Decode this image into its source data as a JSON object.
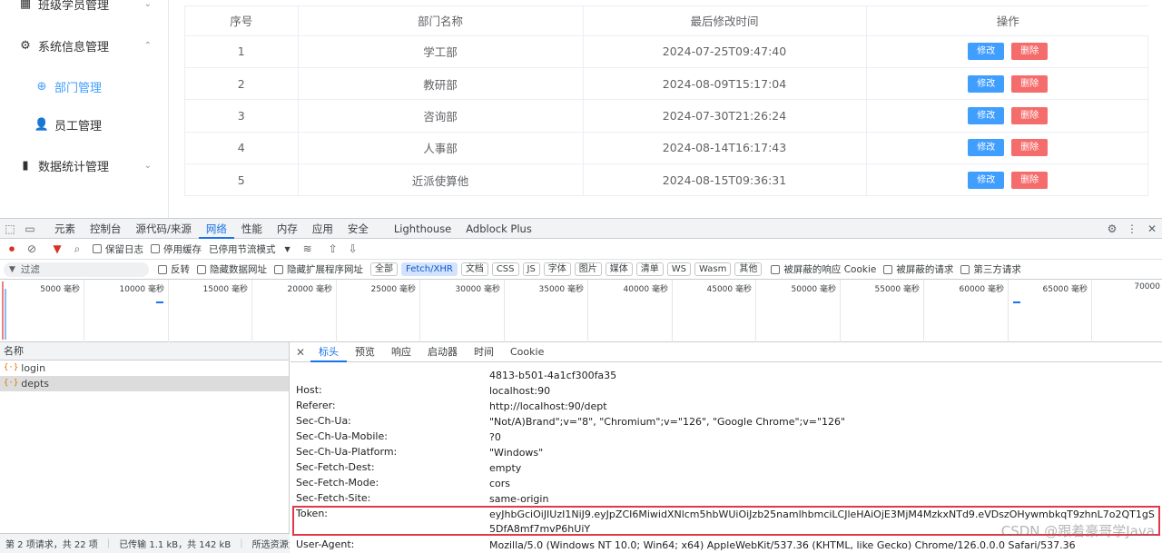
{
  "sidebar": {
    "items": [
      {
        "label": "班级学员管理",
        "icon": "grid-icon",
        "chevron": "down"
      },
      {
        "label": "系统信息管理",
        "icon": "gear-icon",
        "chevron": "up"
      },
      {
        "label": "部门管理",
        "icon": "plus-circle-icon",
        "active": true
      },
      {
        "label": "员工管理",
        "icon": "user-icon"
      },
      {
        "label": "数据统计管理",
        "icon": "bar-chart-icon",
        "chevron": "down"
      }
    ]
  },
  "table": {
    "headers": [
      "序号",
      "部门名称",
      "最后修改时间",
      "操作"
    ],
    "rows": [
      {
        "no": "1",
        "name": "学工部",
        "time": "2024-07-25T09:47:40"
      },
      {
        "no": "2",
        "name": "教研部",
        "time": "2024-08-09T15:17:04"
      },
      {
        "no": "3",
        "name": "咨询部",
        "time": "2024-07-30T21:26:24"
      },
      {
        "no": "4",
        "name": "人事部",
        "time": "2024-08-14T16:17:43"
      },
      {
        "no": "5",
        "name": "近派使算他",
        "time": "2024-08-15T09:36:31"
      }
    ],
    "edit_label": "修改",
    "delete_label": "删除"
  },
  "devtools": {
    "tabs": [
      "元素",
      "控制台",
      "源代码/来源",
      "网络",
      "性能",
      "内存",
      "应用",
      "安全",
      "Lighthouse",
      "Adblock Plus"
    ],
    "active_tab": "网络",
    "toolbar": {
      "preserve_log": "保留日志",
      "disable_cache": "停用缓存",
      "throttle": "已停用节流模式"
    },
    "filter": {
      "placeholder": "过滤",
      "invert": "反转",
      "hide_data_urls": "隐藏数据网址",
      "hide_ext_urls": "隐藏扩展程序网址",
      "chips": [
        "全部",
        "Fetch/XHR",
        "文档",
        "CSS",
        "JS",
        "字体",
        "图片",
        "媒体",
        "清单",
        "WS",
        "Wasm",
        "其他"
      ],
      "active_chip": "Fetch/XHR",
      "blocked_cookies": "被屏蔽的响应 Cookie",
      "blocked_requests": "被屏蔽的请求",
      "third_party": "第三方请求"
    },
    "timeline_labels": [
      "5000 毫秒",
      "10000 毫秒",
      "15000 毫秒",
      "20000 毫秒",
      "25000 毫秒",
      "30000 毫秒",
      "35000 毫秒",
      "40000 毫秒",
      "45000 毫秒",
      "50000 毫秒",
      "55000 毫秒",
      "60000 毫秒",
      "65000 毫秒",
      "70000"
    ],
    "requests": {
      "header": "名称",
      "items": [
        "login",
        "depts"
      ],
      "selected": "depts"
    },
    "status": {
      "requests": "第 2 项请求，共 22 项",
      "transferred": "已传输 1.1 kB，共 142 kB",
      "resources": "所选资源大小"
    },
    "detail_tabs": [
      "标头",
      "预览",
      "响应",
      "启动器",
      "时间",
      "Cookie"
    ],
    "active_detail_tab": "标头",
    "headers": [
      {
        "key": "",
        "value": "4813-b501-4a1cf300fa35"
      },
      {
        "key": "Host:",
        "value": "localhost:90"
      },
      {
        "key": "Referer:",
        "value": "http://localhost:90/dept"
      },
      {
        "key": "Sec-Ch-Ua:",
        "value": "\"Not/A)Brand\";v=\"8\", \"Chromium\";v=\"126\", \"Google Chrome\";v=\"126\""
      },
      {
        "key": "Sec-Ch-Ua-Mobile:",
        "value": "?0"
      },
      {
        "key": "Sec-Ch-Ua-Platform:",
        "value": "\"Windows\""
      },
      {
        "key": "Sec-Fetch-Dest:",
        "value": "empty"
      },
      {
        "key": "Sec-Fetch-Mode:",
        "value": "cors"
      },
      {
        "key": "Sec-Fetch-Site:",
        "value": "same-origin"
      },
      {
        "key": "Token:",
        "value": "eyJhbGciOiJIUzI1NiJ9.eyJpZCI6MiwidXNlcm5hbWUiOiJzb25namlhbmciLCJleHAiOjE3MjM4MzkxNTd9.eVDszOHywmbkqT9zhnL7o2QT1gS5DfA8mf7mvP6hUiY"
      },
      {
        "key": "User-Agent:",
        "value": "Mozilla/5.0 (Windows NT 10.0; Win64; x64) AppleWebKit/537.36 (KHTML, like Gecko) Chrome/126.0.0.0 Safari/537.36"
      }
    ]
  },
  "watermark": "CSDN @跟着豪哥学Java",
  "colors": {
    "accent": "#409eff",
    "danger": "#f56c6c",
    "devtools_accent": "#1a73e8",
    "highlight_box": "#e0394a"
  }
}
